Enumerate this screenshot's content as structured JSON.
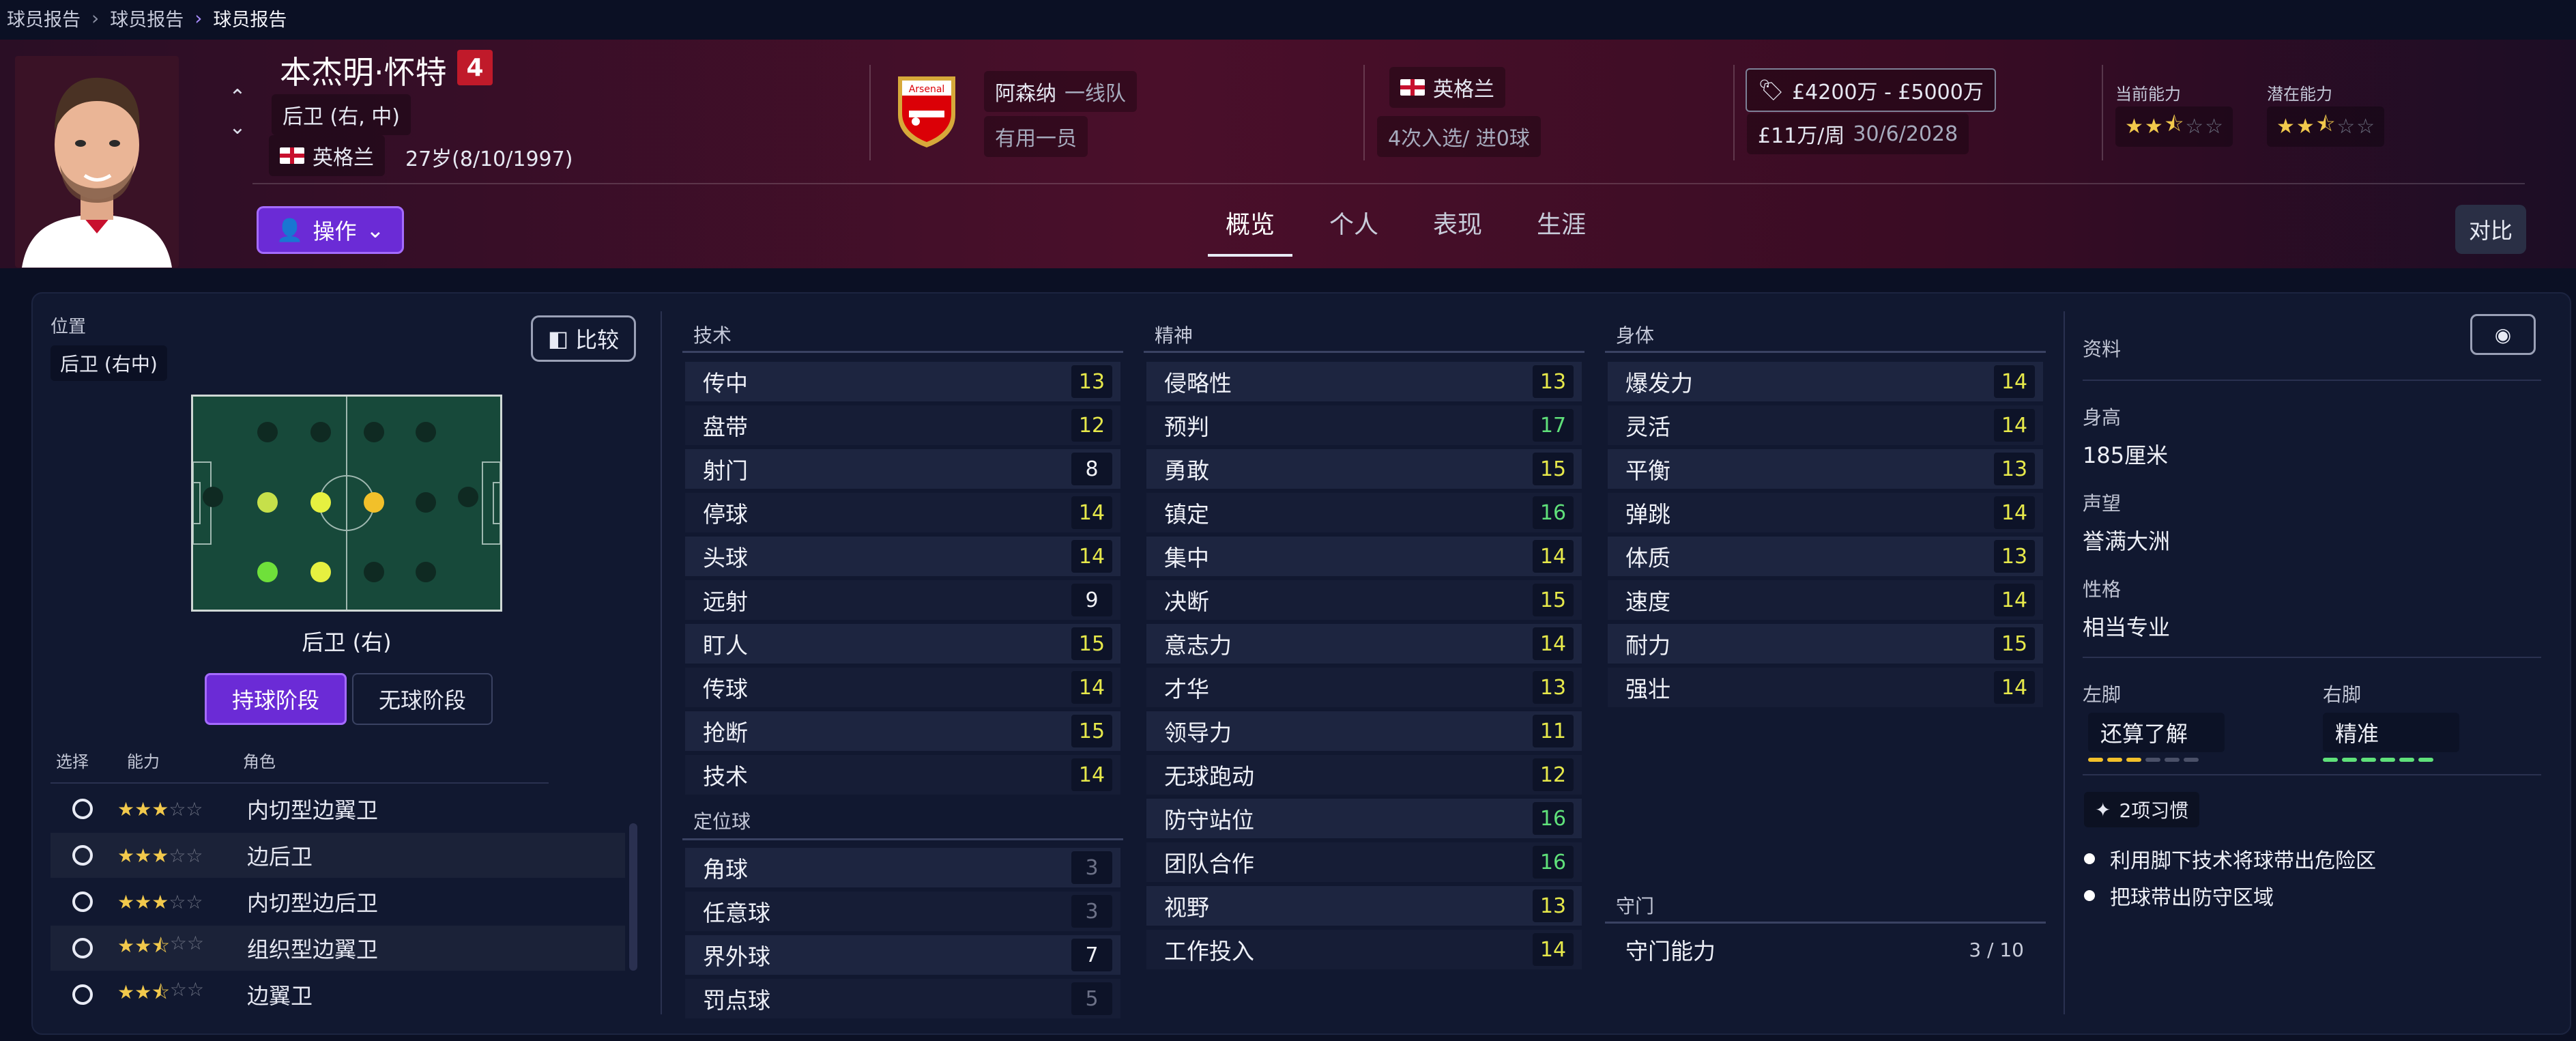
{
  "breadcrumbs": [
    "球员报告",
    "球员报告",
    "球员报告"
  ],
  "player": {
    "name": "本杰明·怀特",
    "number": "4",
    "position": "后卫 (右, 中)",
    "nationality": "英格兰",
    "age": "27岁(8/10/1997)"
  },
  "club": {
    "name": "阿森纳",
    "squad": "一线队",
    "status": "有用一员",
    "badge_text": "Arsenal"
  },
  "international": {
    "nation": "英格兰",
    "caps": "4次入选/ 进0球"
  },
  "contract": {
    "value": "£4200万 - £5000万",
    "wage": "£11万/周",
    "expiry": "30/6/2028"
  },
  "ability": {
    "current_label": "当前能力",
    "current_stars": 2.5,
    "potential_label": "潜在能力",
    "potential_stars": 2.5
  },
  "action_button": "操作",
  "tabs": [
    "概览",
    "个人",
    "表现",
    "生涯"
  ],
  "compare_button": "对比",
  "position_panel": {
    "label": "位置",
    "value": "后卫 (右中)",
    "compare_label": "比较",
    "pitch_caption": "后卫 (右)",
    "phase_in": "持球阶段",
    "phase_out": "无球阶段",
    "col_select": "选择",
    "col_ability": "能力",
    "col_role": "角色"
  },
  "roles": [
    {
      "stars": 3,
      "name": "内切型边翼卫"
    },
    {
      "stars": 3,
      "name": "边后卫"
    },
    {
      "stars": 3,
      "name": "内切型边后卫"
    },
    {
      "stars": 2.5,
      "name": "组织型边翼卫"
    },
    {
      "stars": 2.5,
      "name": "边翼卫"
    }
  ],
  "technical": {
    "title": "技术",
    "rows": [
      {
        "name": "传中",
        "value": "13"
      },
      {
        "name": "盘带",
        "value": "12"
      },
      {
        "name": "射门",
        "value": "8"
      },
      {
        "name": "停球",
        "value": "14"
      },
      {
        "name": "头球",
        "value": "14"
      },
      {
        "name": "远射",
        "value": "9"
      },
      {
        "name": "盯人",
        "value": "15"
      },
      {
        "name": "传球",
        "value": "14"
      },
      {
        "name": "抢断",
        "value": "15"
      },
      {
        "name": "技术",
        "value": "14"
      }
    ]
  },
  "set_pieces": {
    "title": "定位球",
    "rows": [
      {
        "name": "角球",
        "value": "3"
      },
      {
        "name": "任意球",
        "value": "3"
      },
      {
        "name": "界外球",
        "value": "7"
      },
      {
        "name": "罚点球",
        "value": "5"
      }
    ]
  },
  "mental": {
    "title": "精神",
    "rows": [
      {
        "name": "侵略性",
        "value": "13"
      },
      {
        "name": "预判",
        "value": "17"
      },
      {
        "name": "勇敢",
        "value": "15"
      },
      {
        "name": "镇定",
        "value": "16"
      },
      {
        "name": "集中",
        "value": "14"
      },
      {
        "name": "决断",
        "value": "15"
      },
      {
        "name": "意志力",
        "value": "14"
      },
      {
        "name": "才华",
        "value": "13"
      },
      {
        "name": "领导力",
        "value": "11"
      },
      {
        "name": "无球跑动",
        "value": "12"
      },
      {
        "name": "防守站位",
        "value": "16"
      },
      {
        "name": "团队合作",
        "value": "16"
      },
      {
        "name": "视野",
        "value": "13"
      },
      {
        "name": "工作投入",
        "value": "14"
      }
    ]
  },
  "physical": {
    "title": "身体",
    "rows": [
      {
        "name": "爆发力",
        "value": "14"
      },
      {
        "name": "灵活",
        "value": "14"
      },
      {
        "name": "平衡",
        "value": "13"
      },
      {
        "name": "弹跳",
        "value": "14"
      },
      {
        "name": "体质",
        "value": "13"
      },
      {
        "name": "速度",
        "value": "14"
      },
      {
        "name": "耐力",
        "value": "15"
      },
      {
        "name": "强壮",
        "value": "14"
      }
    ]
  },
  "goalkeeping": {
    "title": "守门",
    "label": "守门能力",
    "value": "3 / 10"
  },
  "profile": {
    "title": "资料",
    "height_label": "身高",
    "height": "185厘米",
    "rep_label": "声望",
    "rep": "誉满大洲",
    "pers_label": "性格",
    "pers": "相当专业",
    "left_foot_label": "左脚",
    "left_foot": "还算了解",
    "left_foot_level": 3,
    "right_foot_label": "右脚",
    "right_foot": "精准",
    "right_foot_level": 6,
    "habits_label": "2项习惯",
    "habits": [
      "利用脚下技术将球带出危险区",
      "把球带出防守区域"
    ]
  },
  "colors": {
    "accent": "#6b2bd6",
    "header": "#4a0f2a",
    "panel": "#111830",
    "green_val": "#5fe07a",
    "yellow_val": "#e6e84a"
  }
}
